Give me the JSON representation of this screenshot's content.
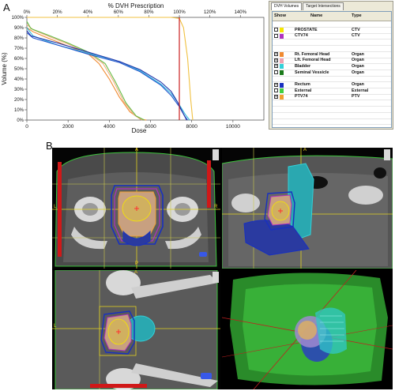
{
  "panel_labels": {
    "a": "A",
    "b": "B"
  },
  "dvh": {
    "top_axis_title": "% DVH Prescription",
    "top_ticks": [
      "0%",
      "20%",
      "40%",
      "60%",
      "80%",
      "100%",
      "120%",
      "140%"
    ],
    "ylabel": "Volume (%)",
    "y_ticks": [
      "100%",
      "90%",
      "80%",
      "70%",
      "60%",
      "50%",
      "40%",
      "30%",
      "20%",
      "10%",
      "0%"
    ],
    "xlabel": "Dose",
    "x_ticks": [
      "0",
      "2000",
      "4000",
      "6000",
      "8000",
      "10000"
    ]
  },
  "chart_data": {
    "type": "line",
    "xlabel": "Dose",
    "ylabel": "Volume (%)",
    "x_top_label": "% DVH Prescription",
    "xlim": [
      0,
      11500
    ],
    "ylim": [
      0,
      100
    ],
    "series": [
      {
        "color": "#f08a30",
        "x": [
          0,
          300,
          1000,
          2000,
          3000,
          3500,
          4000,
          4500,
          5000,
          5500,
          5800
        ],
        "y": [
          90,
          86,
          80,
          72,
          64,
          55,
          40,
          22,
          8,
          1,
          0
        ]
      },
      {
        "color": "#f0b080",
        "x": [
          0,
          300,
          1000,
          2000,
          3000,
          3700,
          4200,
          4700,
          5200,
          5600
        ],
        "y": [
          93,
          88,
          82,
          74,
          65,
          55,
          38,
          18,
          5,
          0
        ]
      },
      {
        "color": "#66bb44",
        "x": [
          0,
          200,
          1000,
          2000,
          3000,
          3800,
          4300,
          4800,
          5300,
          5700
        ],
        "y": [
          96,
          89,
          83,
          75,
          66,
          55,
          37,
          17,
          4,
          0
        ]
      },
      {
        "color": "#33bbdd",
        "x": [
          0,
          300,
          1500,
          3000,
          4500,
          5500,
          6500,
          7000,
          7400,
          7700,
          7900
        ],
        "y": [
          90,
          82,
          73,
          65,
          57,
          48,
          35,
          26,
          15,
          5,
          0
        ]
      },
      {
        "color": "#2255cc",
        "x": [
          0,
          300,
          1500,
          3000,
          4500,
          5500,
          6500,
          7000,
          7400,
          7650,
          7800
        ],
        "y": [
          85,
          80,
          73,
          64,
          56,
          47,
          34,
          24,
          13,
          4,
          0
        ]
      },
      {
        "color": "#2233aa",
        "x": [
          0,
          200,
          1500,
          3000,
          4500,
          5500,
          6500,
          7000,
          7300,
          7600,
          7750
        ],
        "y": [
          87,
          82,
          75,
          66,
          57,
          49,
          37,
          28,
          18,
          6,
          0
        ]
      },
      {
        "color": "#f0c040",
        "x": [
          0,
          7000,
          7400,
          7600,
          7800,
          7950,
          8050
        ],
        "y": [
          100,
          100,
          99,
          90,
          60,
          20,
          0
        ]
      },
      {
        "color": "#cc2222",
        "x": [
          7400,
          7400
        ],
        "y": [
          0,
          100
        ]
      }
    ]
  },
  "dvh_table": {
    "tabs": [
      "DVH Volumes",
      "Target Intersections"
    ],
    "headers": {
      "show": "Show",
      "name": "Name",
      "type": "Type"
    },
    "rows": [
      {
        "checked": false,
        "color": "",
        "name": "",
        "type": ""
      },
      {
        "checked": false,
        "color": "#f5e600",
        "name": "PROSTATE",
        "type": "CTV"
      },
      {
        "checked": false,
        "color": "#b030c0",
        "name": "CTV74",
        "type": "CTV"
      },
      {
        "checked": false,
        "color": "",
        "name": "",
        "type": ""
      },
      {
        "checked": false,
        "color": "",
        "name": "",
        "type": ""
      },
      {
        "checked": true,
        "color": "#f08a30",
        "name": "Rt. Femoral Head",
        "type": "Organ"
      },
      {
        "checked": true,
        "color": "#f0a0b0",
        "name": "Lft. Femoral Head",
        "type": "Organ"
      },
      {
        "checked": true,
        "color": "#33d0d8",
        "name": "Bladder",
        "type": "Organ"
      },
      {
        "checked": false,
        "color": "#1a7a1a",
        "name": "Seminal Vessicle",
        "type": "Organ"
      },
      {
        "checked": false,
        "color": "",
        "name": "",
        "type": ""
      },
      {
        "checked": true,
        "color": "#1830c0",
        "name": "Rectum",
        "type": "Organ"
      },
      {
        "checked": false,
        "color": "#40d040",
        "name": "External",
        "type": "External"
      },
      {
        "checked": true,
        "color": "#f0a030",
        "name": "PTV74",
        "type": "PTV"
      },
      {
        "checked": false,
        "color": "",
        "name": "",
        "type": ""
      },
      {
        "checked": false,
        "color": "",
        "name": "",
        "type": ""
      },
      {
        "checked": false,
        "color": "",
        "name": "",
        "type": ""
      },
      {
        "checked": false,
        "color": "",
        "name": "",
        "type": ""
      }
    ]
  },
  "ct_views": {
    "axial": {
      "top_marker": "A",
      "left_marker": "L",
      "right_marker": "R",
      "bottom_marker": "P"
    },
    "sagittal": {
      "top_marker": "A"
    },
    "coronal": {
      "top_marker": "A",
      "left_marker": "L"
    }
  }
}
